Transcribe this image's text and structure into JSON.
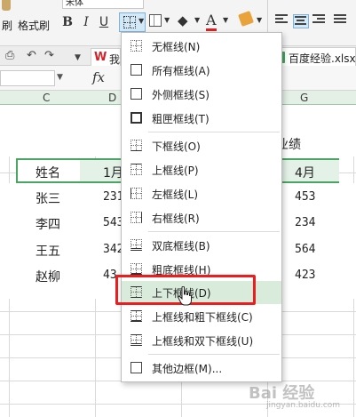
{
  "ribbon": {
    "format_brush_label": "格式刷",
    "font_name": "宋体",
    "bold": "B",
    "italic": "I",
    "underline": "U",
    "font_color_label": "A",
    "accent_color": "#d4e9f7",
    "font_color": "#e02020"
  },
  "quick_toolbar": {
    "app_tab_label": "我",
    "document_title": "百度经验.xlsx"
  },
  "formula_bar": {
    "fx_label": "fx"
  },
  "sheet": {
    "columns": [
      "C",
      "D",
      "G"
    ],
    "title_fragment": "业绩",
    "header_row": [
      "姓名",
      "1月",
      "4月"
    ],
    "rows": [
      {
        "name": "张三",
        "jan": "231",
        "apr": "453"
      },
      {
        "name": "李四",
        "jan": "543",
        "apr": "234"
      },
      {
        "name": "王五",
        "jan": "342",
        "apr": "564"
      },
      {
        "name": "赵柳",
        "jan": "43",
        "apr": "423"
      }
    ],
    "header_border_color": "#4aa564"
  },
  "border_menu": {
    "items": [
      {
        "label": "无框线(N)",
        "icon": "no-border-icon"
      },
      {
        "label": "所有框线(A)",
        "icon": "all-borders-icon"
      },
      {
        "label": "外侧框线(S)",
        "icon": "outside-borders-icon"
      },
      {
        "label": "粗匣框线(T)",
        "icon": "thick-box-border-icon"
      },
      {
        "label": "下框线(O)",
        "icon": "bottom-border-icon"
      },
      {
        "label": "上框线(P)",
        "icon": "top-border-icon"
      },
      {
        "label": "左框线(L)",
        "icon": "left-border-icon"
      },
      {
        "label": "右框线(R)",
        "icon": "right-border-icon"
      },
      {
        "label": "双底框线(B)",
        "icon": "double-bottom-border-icon"
      },
      {
        "label": "粗底框线(H)",
        "icon": "thick-bottom-border-icon"
      },
      {
        "label": "上下框线(D)",
        "icon": "top-bottom-border-icon"
      },
      {
        "label": "上框线和粗下框线(C)",
        "icon": "top-thick-bottom-border-icon"
      },
      {
        "label": "上框线和双下框线(U)",
        "icon": "top-double-bottom-border-icon"
      },
      {
        "label": "其他边框(M)...",
        "icon": "more-borders-icon"
      }
    ],
    "highlight_color": "#ee1c1c",
    "hover_color": "#d9ecdc"
  },
  "watermark": {
    "text": "Bai 经验",
    "sub": "jingyan.baidu.com"
  }
}
